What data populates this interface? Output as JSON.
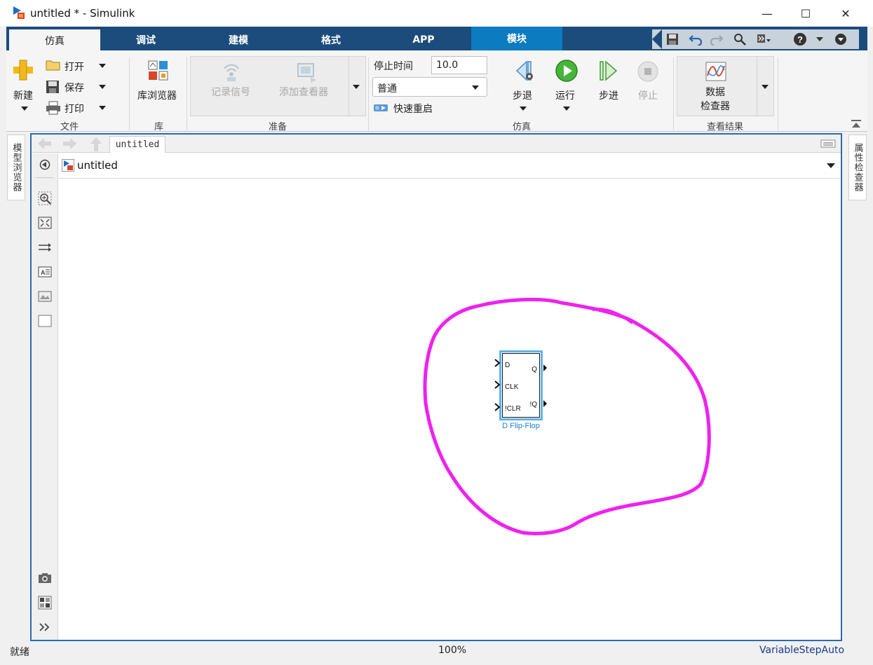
{
  "window": {
    "title": "untitled * - Simulink",
    "minimize_glyph": "—",
    "maximize_glyph": "☐",
    "close_glyph": "✕"
  },
  "tabs": [
    {
      "label": "仿真"
    },
    {
      "label": "调试"
    },
    {
      "label": "建模"
    },
    {
      "label": "格式"
    },
    {
      "label": "APP"
    },
    {
      "label": "模块"
    }
  ],
  "ribbon": {
    "file": {
      "new_label": "新建",
      "open_label": "打开",
      "save_label": "保存",
      "print_label": "打印",
      "section": "文件"
    },
    "library": {
      "browser_label": "库浏览器",
      "section": "库"
    },
    "prepare": {
      "log_signals_label": "记录信号",
      "add_viewer_label": "添加查看器",
      "section": "准备"
    },
    "simulate": {
      "stop_time_label": "停止时间",
      "stop_time_value": "10.0",
      "mode_value": "普通",
      "fast_restart_label": "快速重启",
      "step_back_label": "步退",
      "run_label": "运行",
      "step_forward_label": "步进",
      "stop_label": "停止",
      "section": "仿真"
    },
    "results": {
      "data_inspector_line1": "数据",
      "data_inspector_line2": "检查器",
      "section": "查看结果"
    }
  },
  "side_panels": {
    "left": "模型浏览器",
    "right": "属性检查器"
  },
  "editor": {
    "breadcrumb_tab": "untitled",
    "model_path": "untitled"
  },
  "block": {
    "name": "D Flip-Flop",
    "inputs": [
      "D",
      "CLK",
      "!CLR"
    ],
    "outputs": [
      "Q",
      "!Q"
    ]
  },
  "status": {
    "left": "就绪",
    "zoom": "100%",
    "solver": "VariableStepAuto"
  },
  "colors": {
    "tab_strip": "#1b4c7c",
    "active_module_tab": "#0c7bbf",
    "annotation": "#ee22ee",
    "block_selection": "#63b3e6"
  }
}
